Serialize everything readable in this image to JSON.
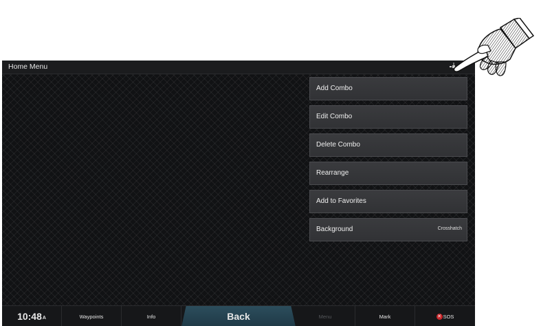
{
  "titlebar": {
    "title": "Home Menu",
    "status_icon": "satellite-icon"
  },
  "menu": {
    "items": [
      {
        "label": "Add Combo",
        "value": ""
      },
      {
        "label": "Edit Combo",
        "value": ""
      },
      {
        "label": "Delete Combo",
        "value": ""
      },
      {
        "label": "Rearrange",
        "value": ""
      },
      {
        "label": "Add to Favorites",
        "value": ""
      },
      {
        "label": "Background",
        "value": "Crosshatch"
      }
    ]
  },
  "bottombar": {
    "clock": "10:48",
    "clock_suffix": "A",
    "waypoints": "Waypoints",
    "info": "Info",
    "back": "Back",
    "menu": "Menu",
    "mark": "Mark",
    "sos": "SOS"
  },
  "colors": {
    "background": "#111214",
    "menu_item": "#36373a",
    "back_button": "#2c4d5c",
    "sos_icon": "#c9272b"
  },
  "decoration": {
    "pointer": "pointing-hand-icon"
  }
}
